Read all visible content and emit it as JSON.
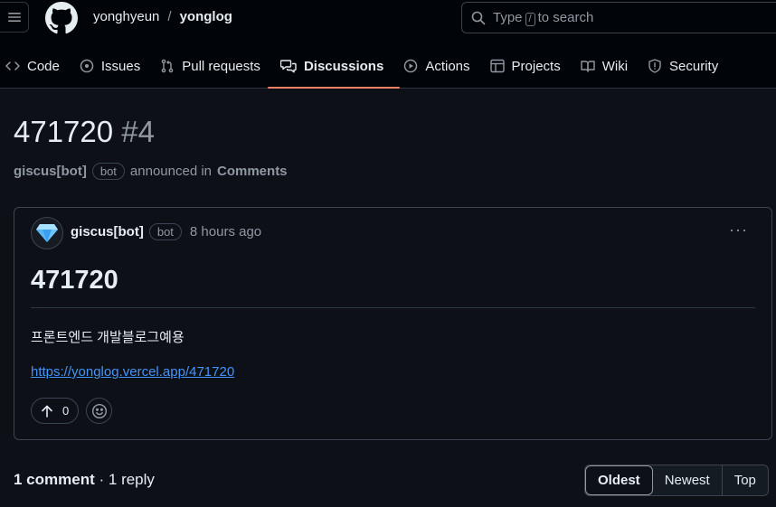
{
  "header": {
    "owner": "yonghyeun",
    "separator": "/",
    "repo": "yonglog",
    "search": {
      "prefix": "Type",
      "key": "/",
      "suffix": "to search"
    }
  },
  "tabs": [
    {
      "label": "Code",
      "icon": "code-icon"
    },
    {
      "label": "Issues",
      "icon": "issue-icon"
    },
    {
      "label": "Pull requests",
      "icon": "pull-request-icon"
    },
    {
      "label": "Discussions",
      "icon": "discussion-icon",
      "active": true
    },
    {
      "label": "Actions",
      "icon": "play-icon"
    },
    {
      "label": "Projects",
      "icon": "table-icon"
    },
    {
      "label": "Wiki",
      "icon": "book-icon"
    },
    {
      "label": "Security",
      "icon": "shield-icon"
    }
  ],
  "discussion": {
    "title": "471720",
    "number": "#4",
    "author": "giscus[bot]",
    "badge": "bot",
    "announced_text": "announced in",
    "category": "Comments"
  },
  "post": {
    "author": "giscus[bot]",
    "badge": "bot",
    "time": "8 hours ago",
    "title": "471720",
    "body": "프론트엔드 개발블로그예용",
    "link": "https://yonglog.vercel.app/471720",
    "upvotes": "0"
  },
  "comments": {
    "count_label": "1 comment",
    "separator": "·",
    "replies_label": "1 reply"
  },
  "sort": {
    "oldest": "Oldest",
    "newest": "Newest",
    "top": "Top",
    "selected": "Oldest"
  },
  "colors": {
    "accent": "#f78166",
    "link": "#4493f8",
    "background": "#0d1117",
    "header": "#010409"
  }
}
